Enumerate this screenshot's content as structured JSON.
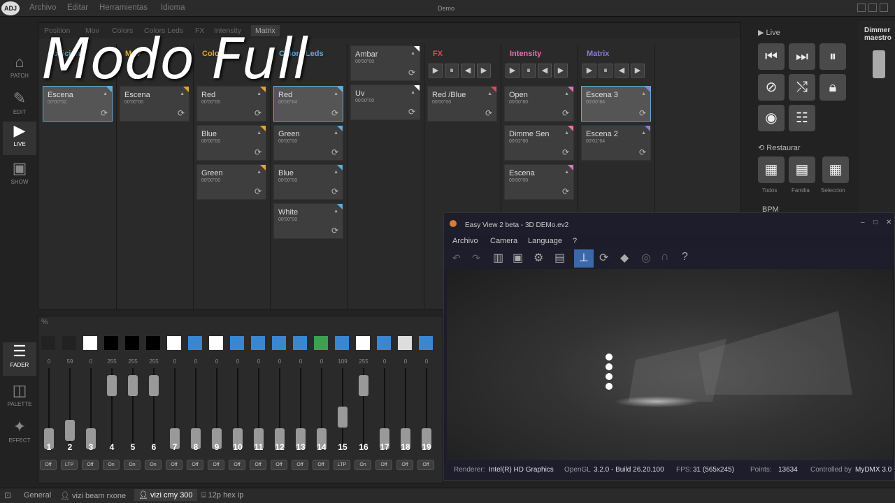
{
  "app": {
    "title": "Demo",
    "logo": "ADJ"
  },
  "menu": [
    "Archivo",
    "Editar",
    "Herramientas",
    "Idioma"
  ],
  "sidebar": [
    {
      "label": "PATCH",
      "icon": "patch-icon"
    },
    {
      "label": "EDIT",
      "icon": "edit-icon"
    },
    {
      "label": "LIVE",
      "icon": "live-icon"
    },
    {
      "label": "SHOW",
      "icon": "show-icon"
    },
    {
      "label": "FADER",
      "icon": "fader-icon"
    },
    {
      "label": "PALETTE",
      "icon": "palette-icon"
    },
    {
      "label": "EFFECT",
      "icon": "effect-icon"
    }
  ],
  "tabs": [
    "Position",
    "Mov",
    "Colors",
    "Colors Leds",
    "FX",
    "Intensity",
    "Matrix"
  ],
  "columns": [
    {
      "head": "Posicion",
      "headColor": "#62a8d8",
      "cards": [
        {
          "name": "Escena",
          "time": "00'00\"52",
          "sel": true
        }
      ]
    },
    {
      "head": "Mov",
      "headColor": "#e6a233",
      "cards": [
        {
          "name": "Escena",
          "time": "00'00\"00"
        }
      ]
    },
    {
      "head": "Colors",
      "headColor": "#e6a233",
      "cards": [
        {
          "name": "Red",
          "time": "00'00\"00"
        },
        {
          "name": "Blue",
          "time": "00'00\"00"
        },
        {
          "name": "Green",
          "time": "00'00\"00"
        }
      ]
    },
    {
      "head": "Colors Leds",
      "headColor": "#62a8d8",
      "cards": [
        {
          "name": "Red",
          "time": "00'00\"64",
          "sel": true
        },
        {
          "name": "Green",
          "time": "00'00\"00"
        },
        {
          "name": "Blue",
          "time": "00'00\"00"
        },
        {
          "name": "White",
          "time": "00'00\"00"
        }
      ]
    },
    {
      "head": "",
      "headColor": "#fff",
      "cards": [
        {
          "name": "Ambar",
          "time": "00'00\"00"
        },
        {
          "name": "Uv",
          "time": "00'00\"00"
        }
      ]
    },
    {
      "head": "FX",
      "headColor": "#e8455a",
      "cards": [
        {
          "name": "Red /Blue",
          "time": "00'00\"00"
        }
      ]
    },
    {
      "head": "Intensity",
      "headColor": "#e86fb0",
      "cards": [
        {
          "name": "Open",
          "time": "00'00\"80"
        },
        {
          "name": "Dimme Sen",
          "time": "00'02\"80"
        },
        {
          "name": "Escena",
          "time": "00'00\"00"
        }
      ]
    },
    {
      "head": "Matrix",
      "headColor": "#8a7fd0",
      "cards": [
        {
          "name": "Escena 3",
          "time": "00'00\"84",
          "sel": true
        },
        {
          "name": "Escena 2",
          "time": "00'01\"64"
        }
      ]
    }
  ],
  "live": {
    "label": "Live",
    "restaurar": "Restaurar",
    "selectors": [
      "Todos",
      "Familia",
      "Seleccion"
    ],
    "bpm": "BPM"
  },
  "dimmer": "Dimmer maestro",
  "faders": [
    {
      "n": "1",
      "v": "0",
      "st": "Off",
      "sw": "#222",
      "k": 0.1
    },
    {
      "n": "2",
      "v": "59",
      "st": "LTP",
      "sw": "#222",
      "k": 0.23
    },
    {
      "n": "3",
      "v": "0",
      "st": "Off",
      "sw": "#fff",
      "k": 0.1
    },
    {
      "n": "4",
      "v": "255",
      "st": "On",
      "sw": "#000",
      "k": 0.9
    },
    {
      "n": "5",
      "v": "255",
      "st": "On",
      "sw": "#000",
      "k": 0.9
    },
    {
      "n": "6",
      "v": "255",
      "st": "On",
      "sw": "#000",
      "k": 0.9
    },
    {
      "n": "7",
      "v": "0",
      "st": "Off",
      "sw": "#fff",
      "k": 0.1
    },
    {
      "n": "8",
      "v": "0",
      "st": "Off",
      "sw": "#3a86d0",
      "k": 0.1
    },
    {
      "n": "9",
      "v": "0",
      "st": "Off",
      "sw": "#fff",
      "k": 0.1
    },
    {
      "n": "10",
      "v": "0",
      "st": "Off",
      "sw": "#3a86d0",
      "k": 0.1
    },
    {
      "n": "11",
      "v": "0",
      "st": "Off",
      "sw": "#3a86d0",
      "k": 0.1
    },
    {
      "n": "12",
      "v": "0",
      "st": "Off",
      "sw": "#3a86d0",
      "k": 0.1
    },
    {
      "n": "13",
      "v": "0",
      "st": "Off",
      "sw": "#3a86d0",
      "k": 0.1
    },
    {
      "n": "14",
      "v": "0",
      "st": "Off",
      "sw": "#3ca050",
      "k": 0.1
    },
    {
      "n": "15",
      "v": "109",
      "st": "LTP",
      "sw": "#3a86d0",
      "k": 0.43
    },
    {
      "n": "16",
      "v": "255",
      "st": "On",
      "sw": "#fff",
      "k": 0.9
    },
    {
      "n": "17",
      "v": "0",
      "st": "Off",
      "sw": "#3a86d0",
      "k": 0.1
    },
    {
      "n": "18",
      "v": "0",
      "st": "Off",
      "sw": "#ddd",
      "k": 0.1
    },
    {
      "n": "19",
      "v": "0",
      "st": "Off",
      "sw": "#3a86d0",
      "k": 0.1
    }
  ],
  "ev": {
    "title": "Easy View 2 beta - 3D DEMo.ev2",
    "menu": [
      "Archivo",
      "Camera",
      "Language",
      "?"
    ],
    "renderer_label": "Renderer:",
    "renderer": "Intel(R) HD Graphics",
    "opengl_label": "OpenGL",
    "opengl": "3.2.0 - Build 26.20.100",
    "fps_label": "FPS:",
    "fps": "31 (565x245)",
    "points_label": "Points:",
    "points": "13634",
    "ctrl_label": "Controlled by",
    "ctrl": "MyDMX 3.0"
  },
  "status_tabs": [
    "General",
    "vizi beam rxone",
    "vizi cmy 300",
    "12p hex ip"
  ],
  "overlay": "Modo Full"
}
